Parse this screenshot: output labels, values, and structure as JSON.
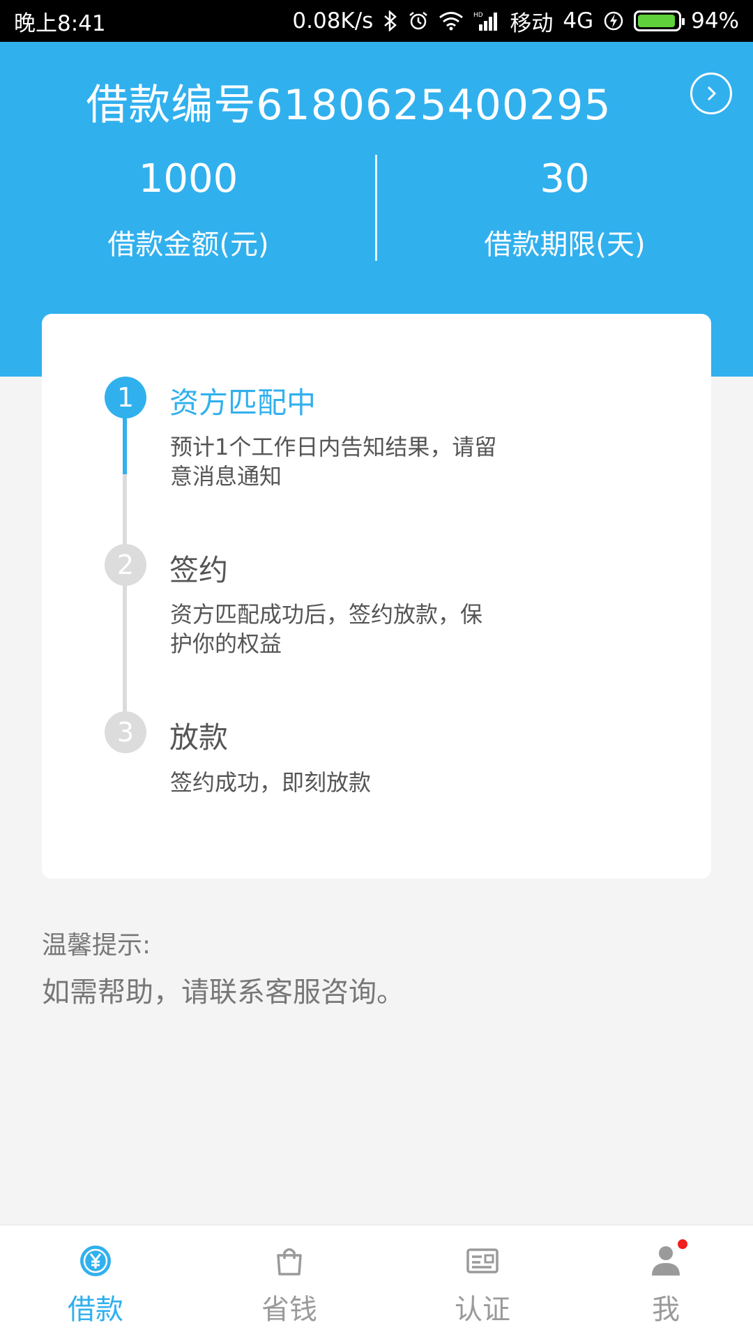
{
  "status_bar": {
    "time": "晚上8:41",
    "net_speed": "0.08K/s",
    "carrier": "移动",
    "network": "4G",
    "battery": "94%",
    "battery_level": 0.94
  },
  "header": {
    "title": "借款编号6180625400295",
    "amount_value": "1000",
    "amount_label": "借款金额(元)",
    "term_value": "30",
    "term_label": "借款期限(天)"
  },
  "steps": [
    {
      "number": "1",
      "title": "资方匹配中",
      "desc_line1": "预计1个工作日内告知结果，请留",
      "desc_line2": "意消息通知",
      "active": true
    },
    {
      "number": "2",
      "title": "签约",
      "desc_line1": "资方匹配成功后，签约放款，保",
      "desc_line2": "护你的权益",
      "active": false
    },
    {
      "number": "3",
      "title": "放款",
      "desc_line1": "签约成功，即刻放款",
      "desc_line2": "",
      "active": false
    }
  ],
  "tips": {
    "title": "温馨提示:",
    "body": "如需帮助，请联系客服咨询。"
  },
  "nav": {
    "items": [
      {
        "label": "借款",
        "icon": "yuan-coin-icon",
        "active": true
      },
      {
        "label": "省钱",
        "icon": "shopping-bag-icon",
        "active": false
      },
      {
        "label": "认证",
        "icon": "id-card-icon",
        "active": false
      },
      {
        "label": "我",
        "icon": "user-icon",
        "active": false
      }
    ]
  },
  "colors": {
    "primary": "#31b0ee",
    "inactive_step": "#dcdcdc",
    "background": "#f4f4f4",
    "notification_dot": "#f02020"
  }
}
